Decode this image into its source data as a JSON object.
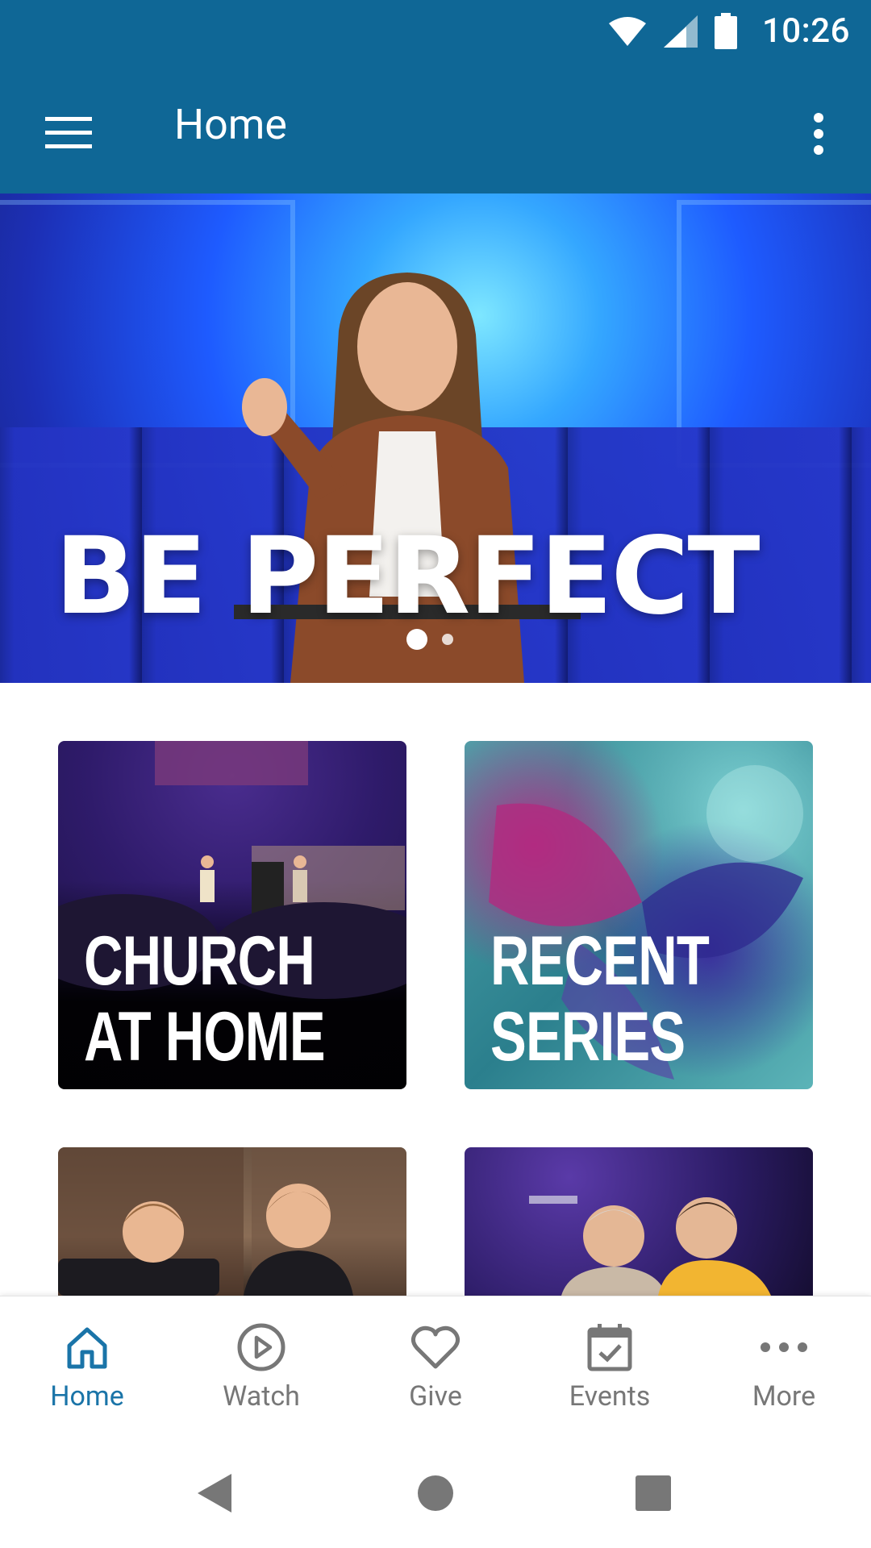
{
  "status_bar": {
    "time": "10:26",
    "icons": [
      "wifi-icon",
      "signal-icon",
      "battery-icon"
    ]
  },
  "app_bar": {
    "title": "Home",
    "menu_icon": "hamburger-menu-icon",
    "overflow_icon": "more-vert-icon"
  },
  "hero": {
    "title": "BE PERFECT",
    "slide_count": 2,
    "active_slide": 1
  },
  "tiles": [
    {
      "label": "CHURCH\nAT HOME"
    },
    {
      "label": "RECENT\nSERIES"
    },
    {
      "label": ""
    },
    {
      "label": ""
    }
  ],
  "bottom_nav": {
    "items": [
      {
        "label": "Home",
        "icon": "home-icon",
        "active": true
      },
      {
        "label": "Watch",
        "icon": "play-circle-icon",
        "active": false
      },
      {
        "label": "Give",
        "icon": "heart-icon",
        "active": false
      },
      {
        "label": "Events",
        "icon": "calendar-check-icon",
        "active": false
      },
      {
        "label": "More",
        "icon": "more-horiz-icon",
        "active": false
      }
    ]
  },
  "colors": {
    "primary": "#0f6796",
    "active_nav": "#1a74a8",
    "inactive_nav": "#777777"
  }
}
